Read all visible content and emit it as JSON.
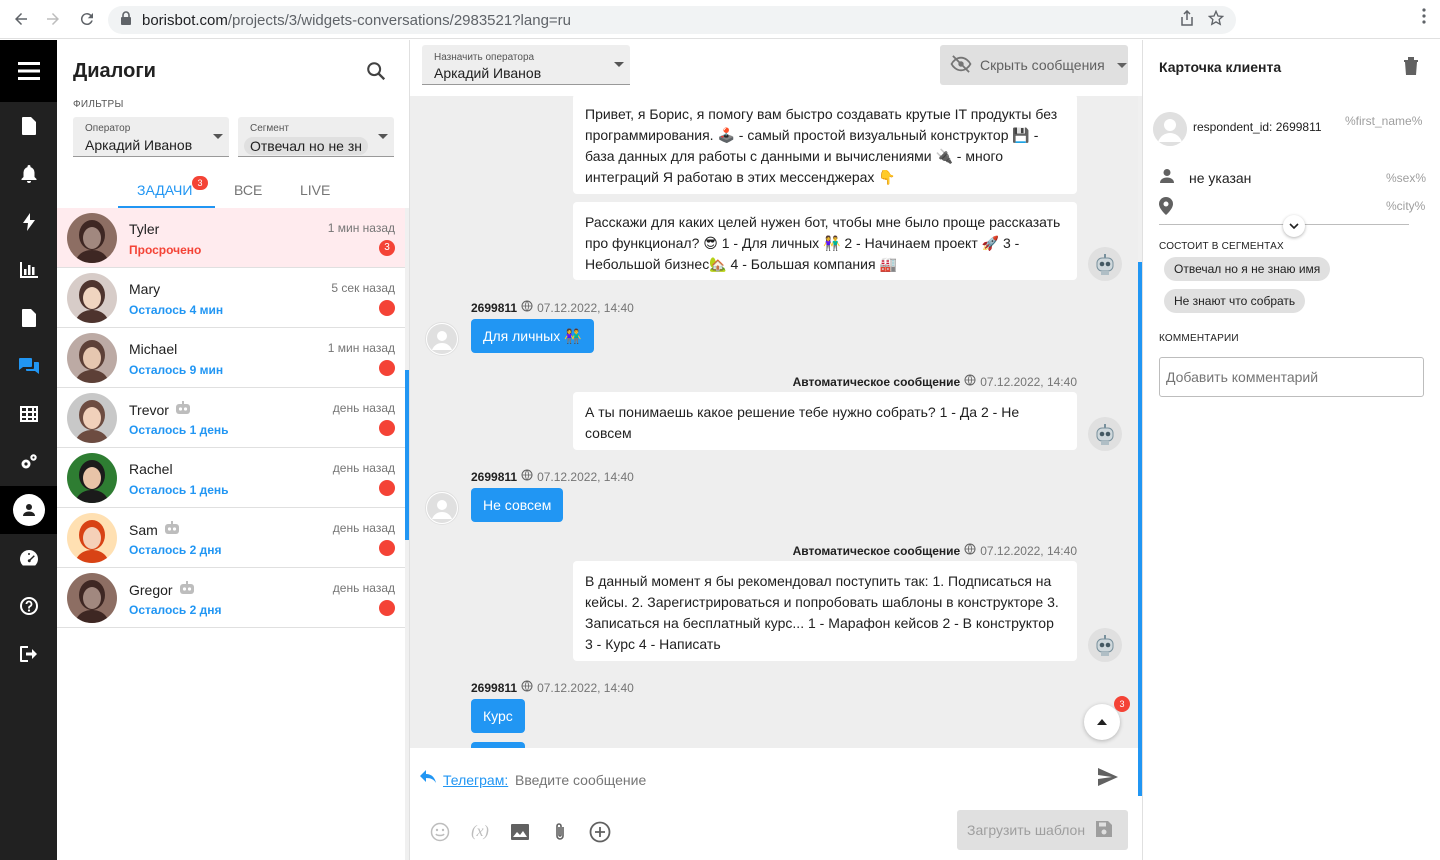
{
  "browser": {
    "url_host": "borisbot.com",
    "url_path": "/projects/3/widgets-conversations/2983521?lang=ru"
  },
  "dialogs": {
    "title": "Диалоги",
    "filters_label": "ФИЛЬТРЫ",
    "operator_filter": {
      "label": "Оператор",
      "value": "Аркадий Иванов"
    },
    "segment_filter": {
      "label": "Сегмент",
      "value": "Отвечал но не зн"
    },
    "tabs": [
      {
        "label": "ЗАДАЧИ",
        "badge": "3",
        "active": true
      },
      {
        "label": "ВСЕ",
        "active": false
      },
      {
        "label": "LIVE",
        "active": false
      }
    ],
    "items": [
      {
        "name": "Tyler",
        "status": "Просрочено",
        "time": "1 мин назад",
        "badge": "3",
        "overdue": true,
        "bot": false
      },
      {
        "name": "Mary",
        "status": "Осталось 4 мин",
        "time": "5 сек назад",
        "badge": "",
        "overdue": false,
        "bot": false
      },
      {
        "name": "Michael",
        "status": "Осталось 9 мин",
        "time": "1 мин назад",
        "badge": "",
        "overdue": false,
        "bot": false
      },
      {
        "name": "Trevor",
        "status": "Осталось 1 день",
        "time": "день назад",
        "badge": "",
        "overdue": false,
        "bot": true
      },
      {
        "name": "Rachel",
        "status": "Осталось 1 день",
        "time": "день назад",
        "badge": "",
        "overdue": false,
        "bot": false
      },
      {
        "name": "Sam",
        "status": "Осталось 2 дня",
        "time": "день назад",
        "badge": "",
        "overdue": false,
        "bot": true
      },
      {
        "name": "Gregor",
        "status": "Осталось 2 дня",
        "time": "день назад",
        "badge": "",
        "overdue": false,
        "bot": true
      }
    ]
  },
  "chat": {
    "operator_select": {
      "label": "Назначить оператора",
      "value": "Аркадий Иванов"
    },
    "hide_button": "Скрыть сообщения",
    "messages": [
      {
        "kind": "bot",
        "text": "Привет, я Борис, я помогу вам быстро создавать крутые IT продукты без программирования. 🕹️ - самый простой визуальный конструктор 💾 - база данных для работы с данными и вычислениями 🔌 - много интеграций Я работаю в этих мессенджерах 👇"
      },
      {
        "kind": "bot",
        "text": "Расскажи для каких целей нужен бот, чтобы мне было проще рассказать про функционал? 😎 1 - Для личных 👫 2 - Начинаем проект 🚀 3 - Небольшой бизнес🏡 4 - Большая компания 🏭"
      },
      {
        "kind": "user_meta",
        "author": "2699811",
        "time": "07.12.2022, 14:40"
      },
      {
        "kind": "user",
        "text": "Для личных 👫"
      },
      {
        "kind": "bot_meta",
        "author": "Автоматическое сообщение",
        "time": "07.12.2022, 14:40"
      },
      {
        "kind": "bot",
        "text": "А ты понимаешь какое решение тебе нужно собрать? 1 - Да 2 - Не совсем"
      },
      {
        "kind": "user_meta",
        "author": "2699811",
        "time": "07.12.2022, 14:40"
      },
      {
        "kind": "user",
        "text": "Не совсем"
      },
      {
        "kind": "bot_meta",
        "author": "Автоматическое сообщение",
        "time": "07.12.2022, 14:40"
      },
      {
        "kind": "bot",
        "text": "В данный момент я бы рекомендовал поступить так: 1. Подписаться на кейсы. 2. Зарегистрироваться и попробовать шаблоны в конструкторе 3. Записаться на бесплатный курс... 1 - Марафон кейсов 2 - В конструктор 3 - Курс 4 - Написать"
      },
      {
        "kind": "user_meta",
        "author": "2699811",
        "time": "07.12.2022, 14:40"
      },
      {
        "kind": "user",
        "text": "Курс"
      }
    ],
    "scroll_badge": "3",
    "channel_label": "Телеграм:",
    "input_placeholder": "Введите сообщение",
    "var_label": "(x)",
    "template_button": "Загрузить шаблон"
  },
  "card": {
    "title": "Карточка клиента",
    "respondent_id": "respondent_id: 2699811",
    "first_name_placeholder": "%first_name%",
    "sex_value": "не указан",
    "sex_placeholder": "%sex%",
    "city_placeholder": "%city%",
    "segments_label": "СОСТОИТ В СЕГМЕНТАХ",
    "segments": [
      "Отвечал но я не знаю имя",
      "Не знают что собрать"
    ],
    "comments_label": "КОММЕНТАРИИ",
    "comment_placeholder": "Добавить комментарий"
  },
  "colors": {
    "accent": "#2196f3",
    "danger": "#f44336",
    "rail": "#212121",
    "chat_bg": "#eeeeee"
  },
  "icons": {
    "rail": [
      "menu-icon",
      "file-icon",
      "bell-icon",
      "bolt-icon",
      "chart-icon",
      "document-icon",
      "chat-icon",
      "table-icon",
      "gears-icon",
      "user-icon",
      "dashboard-icon",
      "help-icon",
      "logout-icon"
    ]
  }
}
